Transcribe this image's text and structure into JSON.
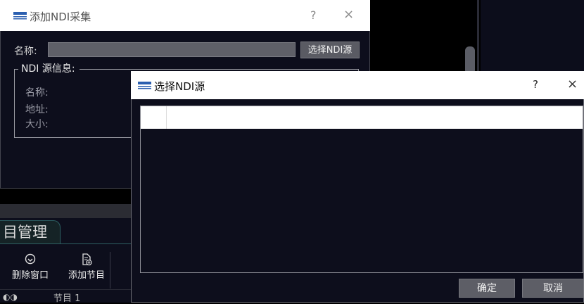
{
  "capture_dialog": {
    "title": "添加NDI采集",
    "help": "?",
    "close": "×",
    "name_label": "名称:",
    "name_value": "",
    "select_button": "选择NDI源",
    "group_title": "NDI 源信息:",
    "info_name_label": "名称:",
    "info_address_label": "地址:",
    "info_size_label": "大小:"
  },
  "source_dialog": {
    "title": "选择NDI源",
    "help": "?",
    "close": "×",
    "ok_button": "确定",
    "cancel_button": "取消"
  },
  "background": {
    "management_tab": "目管理",
    "delete_window": "删除窗口",
    "add_program": "添加节目",
    "program_item": "节目 1"
  },
  "colors": {
    "dark_bg": "#0d0e1c",
    "title_bar": "#ffffff",
    "button_bg": "#5d5e66",
    "tab_accent": "#2d5f62"
  },
  "icons": {
    "app_logo": "app-logo-icon",
    "help": "help-icon",
    "close": "close-icon",
    "delete": "delete-window-icon",
    "add": "add-program-icon"
  }
}
